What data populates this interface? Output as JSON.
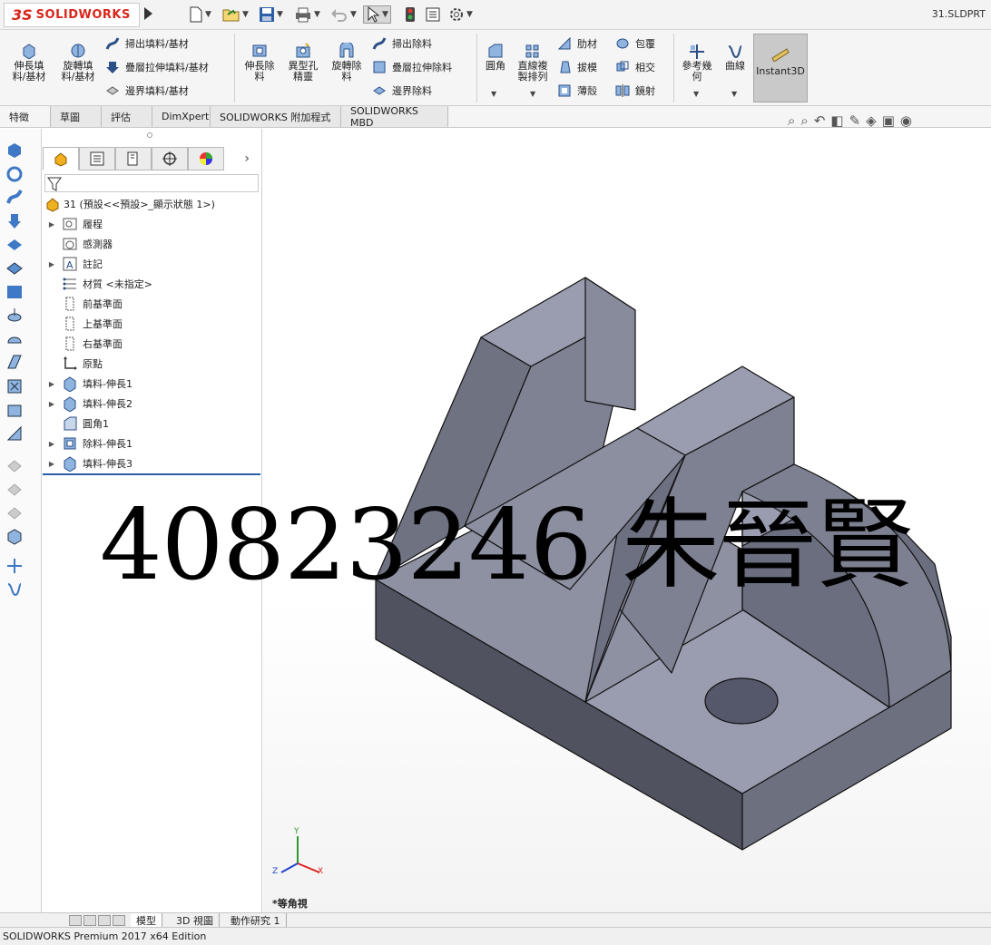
{
  "app": {
    "brand_prefix": "3S",
    "brand": "SOLIDWORKS",
    "document_title": "31.SLDPRT"
  },
  "ribbon": {
    "extrude_boss": "伸長填\n料/基材",
    "revolve_boss": "旋轉填\n料/基材",
    "sweep_boss": "掃出填料/基材",
    "loft_boss": "疊層拉伸填料/基材",
    "boundary_boss": "邊界填料/基材",
    "extrude_cut": "伸長除\n料",
    "hole_wizard": "異型孔\n精靈",
    "revolve_cut": "旋轉除\n料",
    "sweep_cut": "掃出除料",
    "loft_cut": "疊層拉伸除料",
    "boundary_cut": "邊界除料",
    "fillet": "圓角",
    "linear_pattern": "直線複\n製排列",
    "rib": "肋材",
    "draft": "拔模",
    "shell": "薄殼",
    "wrap": "包覆",
    "intersect": "相交",
    "mirror": "鏡射",
    "reference_geometry": "參考幾\n何",
    "curves": "曲線",
    "instant3d": "Instant3D"
  },
  "tabs": [
    "特徵",
    "草圖",
    "評估",
    "DimXpert",
    "SOLIDWORKS 附加程式",
    "SOLIDWORKS MBD"
  ],
  "tree": {
    "root": "31 (預設<<預設>_顯示狀態 1>)",
    "items": [
      {
        "label": "履程",
        "expandable": true
      },
      {
        "label": "感測器",
        "expandable": false
      },
      {
        "label": "註記",
        "expandable": true
      },
      {
        "label": "材質 <未指定>",
        "expandable": false
      },
      {
        "label": "前基準面",
        "expandable": false
      },
      {
        "label": "上基準面",
        "expandable": false
      },
      {
        "label": "右基準面",
        "expandable": false
      },
      {
        "label": "原點",
        "expandable": false
      },
      {
        "label": "填料-伸長1",
        "expandable": true
      },
      {
        "label": "填料-伸長2",
        "expandable": true
      },
      {
        "label": "圓角1",
        "expandable": false
      },
      {
        "label": "除料-伸長1",
        "expandable": true
      },
      {
        "label": "填料-伸長3",
        "expandable": true
      }
    ]
  },
  "viewport": {
    "view_name": "*等角視",
    "watermark": "40823246 朱晉賢",
    "axis_x": "X",
    "axis_y": "Y",
    "axis_z": "Z"
  },
  "bottom_tabs": [
    "模型",
    "3D 視圖",
    "動作研究 1"
  ],
  "status": "SOLIDWORKS Premium 2017 x64 Edition"
}
